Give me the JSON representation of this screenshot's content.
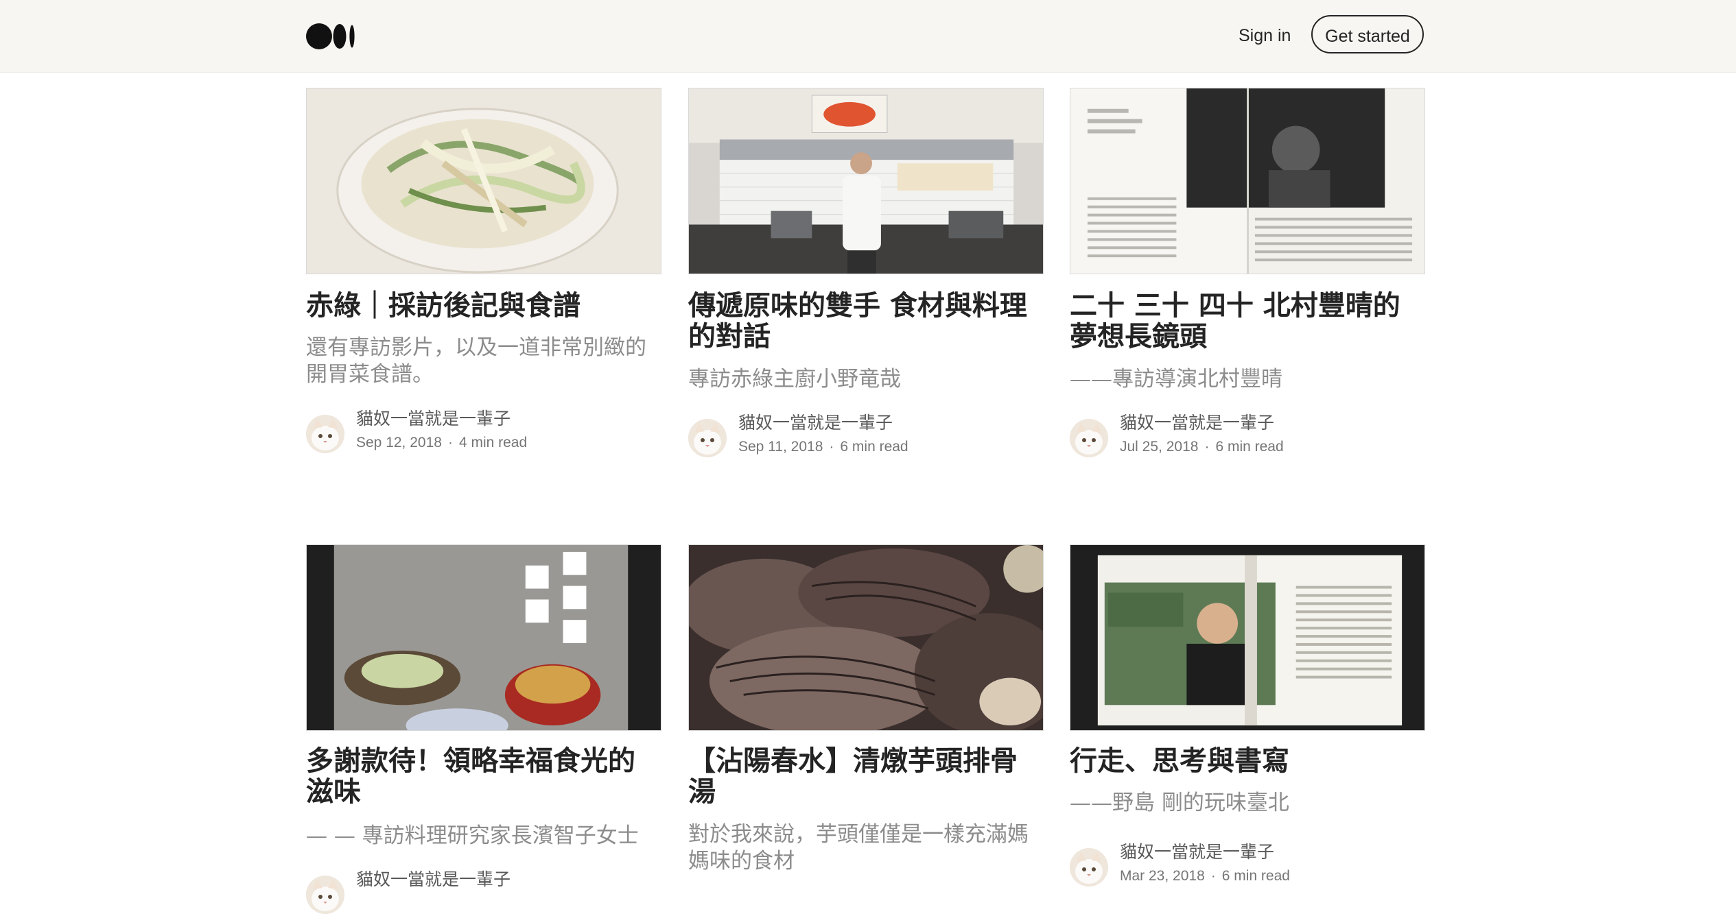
{
  "header": {
    "logo_icon": "medium-logo-icon",
    "signin_label": "Sign in",
    "get_started_label": "Get started"
  },
  "colors": {
    "header_bg": "#f7f6f2",
    "text": "#242424",
    "subtitle": "#8c8c8c",
    "meta": "#757575"
  },
  "posts": [
    {
      "title": "赤綠｜採訪後記與食譜",
      "subtitle": "還有專訪影片，以及一道非常別緻的開胃菜食譜。",
      "author": "貓奴一當就是一輩子",
      "date": "Sep 12, 2018",
      "read_time": "4 min read"
    },
    {
      "title": "傳遞原味的雙手 食材與料理的對話",
      "subtitle": "專訪赤綠主廚小野竜哉",
      "author": "貓奴一當就是一輩子",
      "date": "Sep 11, 2018",
      "read_time": "6 min read"
    },
    {
      "title": "二十 三十 四十 北村豐晴的夢想長鏡頭",
      "subtitle": "——專訪導演北村豐晴",
      "author": "貓奴一當就是一輩子",
      "date": "Jul 25, 2018",
      "read_time": "6 min read"
    },
    {
      "title": "多謝款待！領略幸福食光的滋味",
      "subtitle": "— — 專訪料理研究家長濱智子女士",
      "author": "貓奴一當就是一輩子",
      "date": "",
      "read_time": ""
    },
    {
      "title": "【沾陽春水】清燉芋頭排骨湯",
      "subtitle": "對於我來說，芋頭僅僅是一樣充滿媽媽味的食材",
      "author": "",
      "date": "",
      "read_time": ""
    },
    {
      "title": "行走、思考與書寫",
      "subtitle": "——野島 剛的玩味臺北",
      "author": "貓奴一當就是一輩子",
      "date": "Mar 23, 2018",
      "read_time": "6 min read"
    }
  ]
}
